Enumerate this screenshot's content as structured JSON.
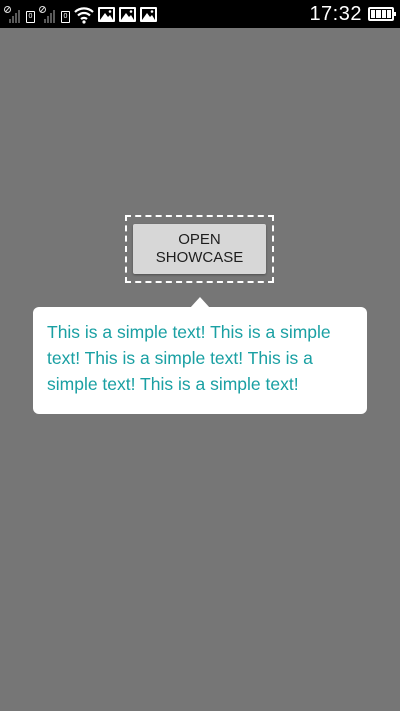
{
  "status_bar": {
    "time": "17:32",
    "sim1_label": "0",
    "sim2_label": "0",
    "icons": [
      "signal-1-icon",
      "sim-1-icon",
      "signal-2-icon",
      "sim-2-icon",
      "wifi-icon",
      "image-icon",
      "image-icon",
      "image-icon",
      "battery-icon"
    ],
    "battery_level": 1.0
  },
  "showcase": {
    "button_label": "OPEN\nSHOWCASE",
    "tooltip_text": "This is a simple text! This is a simple text! This is a simple text! This is a simple text! This is a simple text!"
  },
  "colors": {
    "overlay": "#767676",
    "button_bg": "#d7d7d7",
    "tooltip_bg": "#ffffff",
    "tooltip_text": "#1aa0a3"
  }
}
